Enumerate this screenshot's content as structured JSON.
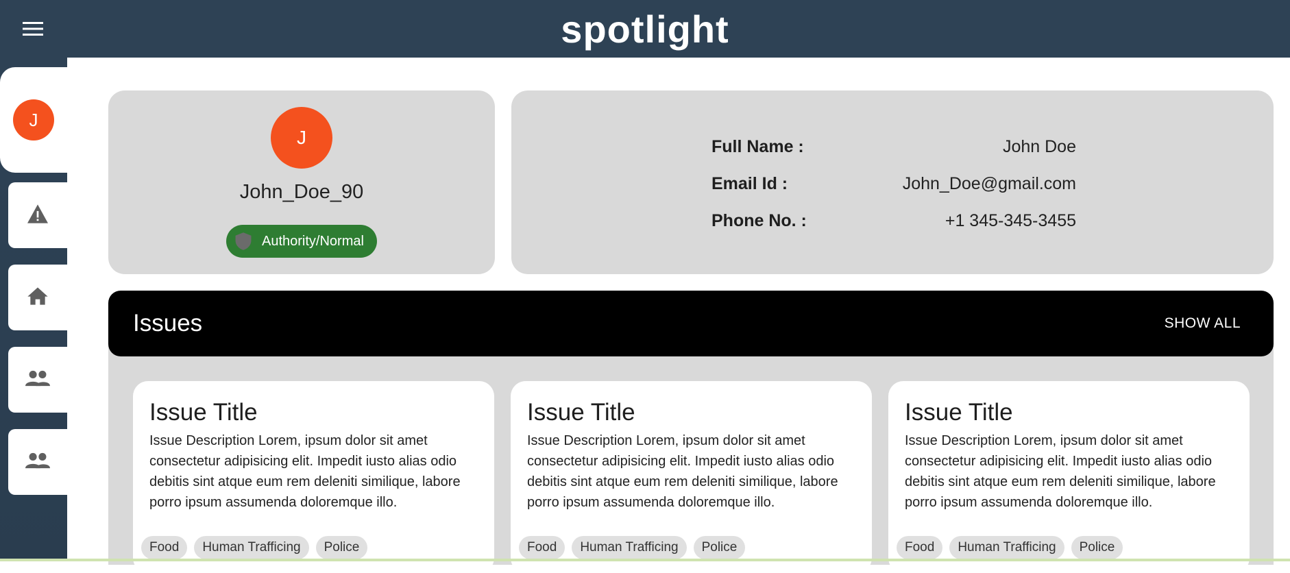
{
  "app": {
    "title": "spotlight"
  },
  "sidebar": {
    "avatar_initial": "J",
    "items": [
      {
        "icon": "warning-icon"
      },
      {
        "icon": "home-icon"
      },
      {
        "icon": "people-icon"
      },
      {
        "icon": "people-icon"
      }
    ]
  },
  "profile": {
    "avatar_initial": "J",
    "username": "John_Doe_90",
    "role": "Authority/Normal"
  },
  "info": {
    "full_name_label": "Full Name :",
    "full_name": "John Doe",
    "email_label": "Email Id :",
    "email": "John_Doe@gmail.com",
    "phone_label": "Phone No. :",
    "phone": "+1 345-345-3455"
  },
  "issues": {
    "heading": "Issues",
    "show_all": "SHOW ALL",
    "cards": [
      {
        "title": "Issue Title",
        "description": "Issue Description Lorem, ipsum dolor sit amet consectetur adipisicing elit. Impedit iusto alias odio debitis sint atque eum rem deleniti similique, labore porro ipsum assumenda doloremque illo.",
        "tags": [
          "Food",
          "Human Trafficing",
          "Police"
        ]
      },
      {
        "title": "Issue Title",
        "description": "Issue Description Lorem, ipsum dolor sit amet consectetur adipisicing elit. Impedit iusto alias odio debitis sint atque eum rem deleniti similique, labore porro ipsum assumenda doloremque illo.",
        "tags": [
          "Food",
          "Human Trafficing",
          "Police"
        ]
      },
      {
        "title": "Issue Title",
        "description": "Issue Description Lorem, ipsum dolor sit amet consectetur adipisicing elit. Impedit iusto alias odio debitis sint atque eum rem deleniti similique, labore porro ipsum assumenda doloremque illo.",
        "tags": [
          "Food",
          "Human Trafficing",
          "Police"
        ]
      }
    ]
  },
  "colors": {
    "header_bg": "#2e4255",
    "avatar": "#f4511e",
    "role_chip": "#2e7d32",
    "card_bg": "#d9d9d9"
  }
}
